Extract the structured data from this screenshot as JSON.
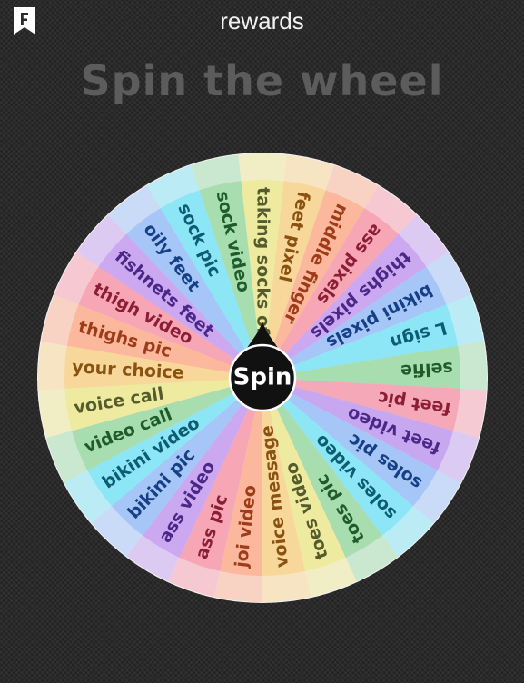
{
  "header": {
    "title": "rewards",
    "brand_icon": "bookmark-f-icon"
  },
  "heading": "Spin the wheel",
  "wheel": {
    "spin_label": "Spin",
    "rim_color": "#f3f3f3",
    "hub_color": "#111111",
    "segments": [
      {
        "label": "taking socks off",
        "color": "#eeeaa0",
        "text": "#555c2c"
      },
      {
        "label": "feet pixel",
        "color": "#f8d79a",
        "text": "#8a5210"
      },
      {
        "label": "middle finger",
        "color": "#fbb89c",
        "text": "#9e3c1a"
      },
      {
        "label": "ass pixels",
        "color": "#f7a6b6",
        "text": "#8c1e34"
      },
      {
        "label": "thighs pixels",
        "color": "#cba8f0",
        "text": "#4b2788"
      },
      {
        "label": "bikini pixels",
        "color": "#a5c6f7",
        "text": "#163f86"
      },
      {
        "label": "L sign",
        "color": "#8de6f6",
        "text": "#0c5c72"
      },
      {
        "label": "selfie",
        "color": "#a8ddb0",
        "text": "#1f5c2a"
      },
      {
        "label": "feet pic",
        "color": "#f5a8b8",
        "text": "#8c1e34"
      },
      {
        "label": "feet video",
        "color": "#c7a8f0",
        "text": "#4b2788"
      },
      {
        "label": "soles pic",
        "color": "#a5c6f7",
        "text": "#163f86"
      },
      {
        "label": "soles video",
        "color": "#8de6f6",
        "text": "#0c5c72"
      },
      {
        "label": "toes pic",
        "color": "#a8ddb0",
        "text": "#1f5c2a"
      },
      {
        "label": "toes video",
        "color": "#eeeaa0",
        "text": "#555c2c"
      },
      {
        "label": "voice message",
        "color": "#f8d79a",
        "text": "#8a5210"
      },
      {
        "label": "joi video",
        "color": "#fbb89c",
        "text": "#9e3c1a"
      },
      {
        "label": "ass pic",
        "color": "#f7a6b6",
        "text": "#8c1e34"
      },
      {
        "label": "ass video",
        "color": "#cba8f0",
        "text": "#4b2788"
      },
      {
        "label": "bikini pic",
        "color": "#a5c6f7",
        "text": "#163f86"
      },
      {
        "label": "bikini video",
        "color": "#8de6f6",
        "text": "#0c5c72"
      },
      {
        "label": "video call",
        "color": "#a8ddb0",
        "text": "#1f5c2a"
      },
      {
        "label": "voice call",
        "color": "#eeeaa0",
        "text": "#555c2c"
      },
      {
        "label": "your choice",
        "color": "#f8d79a",
        "text": "#8a5210"
      },
      {
        "label": "thighs pic",
        "color": "#fbb89c",
        "text": "#9e3c1a"
      },
      {
        "label": "thigh video",
        "color": "#f7a6b6",
        "text": "#8c1e34"
      },
      {
        "label": "fishnets feet",
        "color": "#cba8f0",
        "text": "#4b2788"
      },
      {
        "label": "oily feet",
        "color": "#a5c6f7",
        "text": "#163f86"
      },
      {
        "label": "sock pic",
        "color": "#8de6f6",
        "text": "#0c5c72"
      },
      {
        "label": "sock video",
        "color": "#a8ddb0",
        "text": "#1f5c2a"
      }
    ]
  }
}
